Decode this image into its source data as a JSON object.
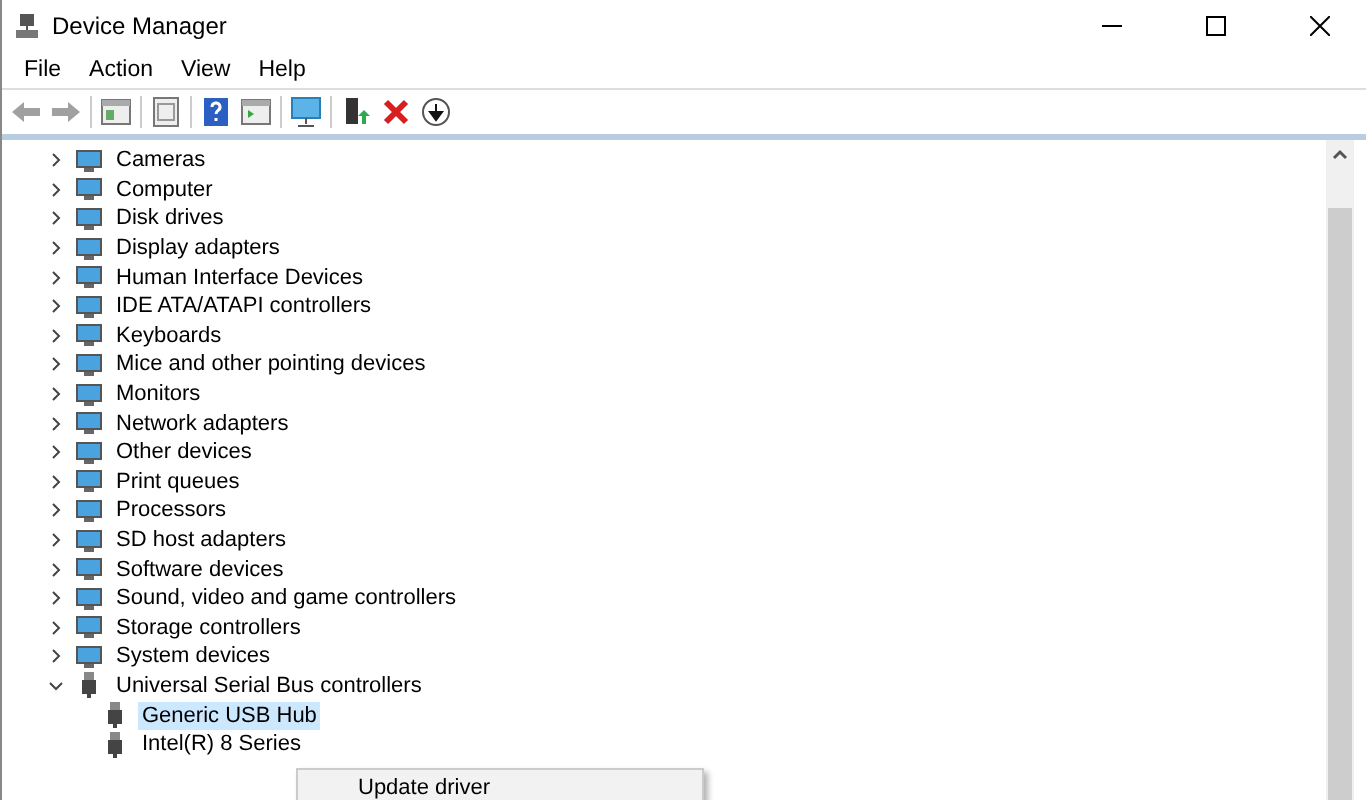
{
  "window": {
    "title": "Device Manager"
  },
  "menu": [
    "File",
    "Action",
    "View",
    "Help"
  ],
  "toolbar": [
    {
      "kind": "back",
      "disabled": true
    },
    {
      "kind": "forward",
      "disabled": true
    },
    {
      "kind": "separator"
    },
    {
      "kind": "console"
    },
    {
      "kind": "separator"
    },
    {
      "kind": "properties"
    },
    {
      "kind": "separator"
    },
    {
      "kind": "help"
    },
    {
      "kind": "view"
    },
    {
      "kind": "separator"
    },
    {
      "kind": "scan"
    },
    {
      "kind": "separator"
    },
    {
      "kind": "update"
    },
    {
      "kind": "uninstall"
    },
    {
      "kind": "disable"
    }
  ],
  "tree": [
    {
      "label": "Cameras",
      "expanded": false
    },
    {
      "label": "Computer",
      "expanded": false
    },
    {
      "label": "Disk drives",
      "expanded": false
    },
    {
      "label": "Display adapters",
      "expanded": false
    },
    {
      "label": "Human Interface Devices",
      "expanded": false
    },
    {
      "label": "IDE ATA/ATAPI controllers",
      "expanded": false
    },
    {
      "label": "Keyboards",
      "expanded": false
    },
    {
      "label": "Mice and other pointing devices",
      "expanded": false
    },
    {
      "label": "Monitors",
      "expanded": false
    },
    {
      "label": "Network adapters",
      "expanded": false
    },
    {
      "label": "Other devices",
      "expanded": false
    },
    {
      "label": "Print queues",
      "expanded": false
    },
    {
      "label": "Processors",
      "expanded": false
    },
    {
      "label": "SD host adapters",
      "expanded": false
    },
    {
      "label": "Software devices",
      "expanded": false
    },
    {
      "label": "Sound, video and game controllers",
      "expanded": false
    },
    {
      "label": "Storage controllers",
      "expanded": false
    },
    {
      "label": "System devices",
      "expanded": false
    },
    {
      "label": "Universal Serial Bus controllers",
      "expanded": true,
      "children": [
        {
          "label": "Generic USB Hub",
          "selected": true
        },
        {
          "label": "Intel(R) 8 Series",
          "selected": false
        }
      ]
    }
  ],
  "context_menu": [
    "Update driver"
  ]
}
